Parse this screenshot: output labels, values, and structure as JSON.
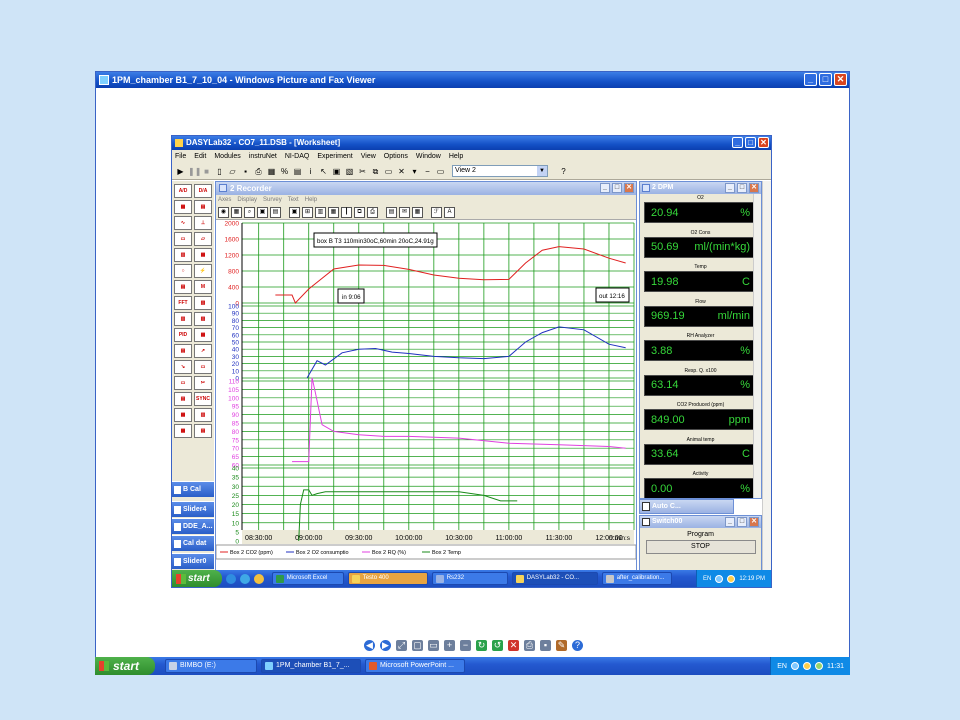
{
  "viewer": {
    "title": "1PM_chamber B1_7_10_04  - Windows Picture and Fax Viewer",
    "toolbar_icons": [
      "previous-icon",
      "next-icon",
      "best-fit-icon",
      "actual-size-icon",
      "slideshow-icon",
      "zoom-in-icon",
      "zoom-out-icon",
      "rotate-clockwise-icon",
      "rotate-counterclockwise-icon",
      "delete-icon",
      "print-icon",
      "save-icon",
      "edit-icon",
      "help-icon"
    ]
  },
  "outer_taskbar": {
    "start_label": "start",
    "items": [
      "BIMBO (E:)",
      "1PM_chamber B1_7_...",
      "Microsoft PowerPoint ..."
    ],
    "lang": "EN",
    "clock": "11:31"
  },
  "dasylab": {
    "title": "DASYLab32 - CO7_11.DSB - [Worksheet]",
    "menu": [
      "File",
      "Edit",
      "Modules",
      "instruNet",
      "NI-DAQ",
      "Experiment",
      "View",
      "Options",
      "Window",
      "Help"
    ],
    "view_select": "View 2"
  },
  "palette_tabs": [
    "B Cal",
    "Slider4",
    "DDE_A...",
    "Cal dat",
    "Slider0"
  ],
  "recorder": {
    "title": "2 Recorder",
    "menu": [
      "Axes",
      "Display",
      "Survey",
      "Text",
      "Help"
    ],
    "annotations": {
      "top_box": "box B T3 110min30oC,60min 20oC,24.91g",
      "in_box": "in 9:06",
      "out_box": "out 12:16"
    },
    "time_unit": "h:min:s",
    "legend": [
      "Box 2 CO2 (ppm)",
      "Box 2 O2 consumptio",
      "Box 2 RQ (%)",
      "Box 2 Temp"
    ]
  },
  "chart_data": {
    "type": "line",
    "x_ticks": [
      "08:30:00",
      "09:00:00",
      "09:30:00",
      "10:00:00",
      "10:30:00",
      "11:00:00",
      "11:30:00",
      "12:00:00"
    ],
    "panels": [
      {
        "name": "Box 2 CO2 (ppm)",
        "color": "#e02020",
        "ylim": [
          0,
          2000
        ],
        "ticks": [
          "0",
          "400",
          "800",
          "1200",
          "1600",
          "2000"
        ],
        "x": [
          "08:40",
          "08:50",
          "08:52",
          "09:00",
          "09:15",
          "09:30",
          "09:45",
          "10:00",
          "10:15",
          "10:30",
          "10:45",
          "11:00",
          "11:10",
          "11:20",
          "11:30",
          "11:45",
          "12:00",
          "12:10"
        ],
        "y": [
          200,
          200,
          0,
          350,
          850,
          950,
          940,
          840,
          700,
          620,
          580,
          590,
          1000,
          1320,
          1410,
          1350,
          1120,
          1000
        ]
      },
      {
        "name": "Box 2 O2 consumptio",
        "color": "#2030c0",
        "ylim": [
          0,
          100
        ],
        "ticks": [
          "0",
          "10",
          "20",
          "30",
          "40",
          "50",
          "60",
          "70",
          "80",
          "90",
          "100"
        ],
        "x": [
          "08:59",
          "09:05",
          "09:10",
          "09:20",
          "09:30",
          "09:40",
          "09:50",
          "10:00",
          "10:15",
          "10:30",
          "10:45",
          "11:00",
          "11:10",
          "11:20",
          "11:30",
          "11:45",
          "12:00",
          "12:10"
        ],
        "y": [
          0,
          24,
          18,
          35,
          40,
          41,
          36,
          34,
          30,
          28,
          27,
          30,
          50,
          63,
          71,
          67,
          47,
          42
        ]
      },
      {
        "name": "Box 2 RQ (%)",
        "color": "#e040e0",
        "ylim": [
          60,
          110
        ],
        "ticks": [
          "60",
          "65",
          "70",
          "75",
          "80",
          "85",
          "90",
          "95",
          "100",
          "105",
          "110"
        ],
        "x": [
          "08:50",
          "09:00",
          "09:02",
          "09:04",
          "09:08",
          "09:15",
          "09:30",
          "09:45",
          "10:00",
          "10:30",
          "11:00",
          "11:30",
          "12:00",
          "12:10"
        ],
        "y": [
          62,
          62,
          112,
          103,
          84,
          80,
          78,
          77,
          77,
          76,
          73,
          72,
          71,
          70
        ]
      },
      {
        "name": "Box 2 Temp",
        "color": "#1a8a1a",
        "ylim": [
          0,
          40
        ],
        "ticks": [
          "0",
          "5",
          "10",
          "15",
          "20",
          "25",
          "30",
          "35",
          "40"
        ],
        "x": [
          "08:54",
          "08:55",
          "08:57",
          "09:00",
          "09:02",
          "09:05",
          "09:10",
          "09:30",
          "10:00",
          "10:30",
          "10:45",
          "10:55",
          "11:05"
        ],
        "y": [
          0,
          20,
          28,
          28,
          25,
          26,
          27,
          27,
          27,
          27,
          25,
          22,
          22
        ]
      }
    ]
  },
  "dpm": {
    "title": "2 DPM",
    "items": [
      {
        "label": "O2",
        "value": "20.94",
        "unit": "%"
      },
      {
        "label": "O2 Cons",
        "value": "50.69",
        "unit": "ml/(min*kg)"
      },
      {
        "label": "Temp",
        "value": "19.98",
        "unit": "C"
      },
      {
        "label": "Flow",
        "value": "969.19",
        "unit": "ml/min"
      },
      {
        "label": "RH Analyzer",
        "value": "3.88",
        "unit": "%"
      },
      {
        "label": "Resp. Q. x100",
        "value": "63.14",
        "unit": "%"
      },
      {
        "label": "CO2 Produced (ppm)",
        "value": "849.00",
        "unit": "ppm"
      },
      {
        "label": "Animal temp",
        "value": "33.64",
        "unit": "C"
      },
      {
        "label": "Activity",
        "value": "0.00",
        "unit": "%"
      }
    ]
  },
  "auto_c": {
    "title": "Auto C..."
  },
  "switch": {
    "title": "Switch00",
    "program_label": "Program",
    "stop_label": "STOP"
  },
  "inner_taskbar": {
    "start_label": "start",
    "items": [
      "Microsoft Excel",
      "Testo 400",
      "Rs232",
      "DASYLab32 - CO...",
      "after_calibration..."
    ],
    "lang": "EN",
    "clock": "12:19 PM"
  },
  "colors": {
    "xp_blue": "#1451c7",
    "grid_green": "#1a9a1a",
    "display_green": "#36d83a",
    "bg": "#cfe4f7"
  }
}
